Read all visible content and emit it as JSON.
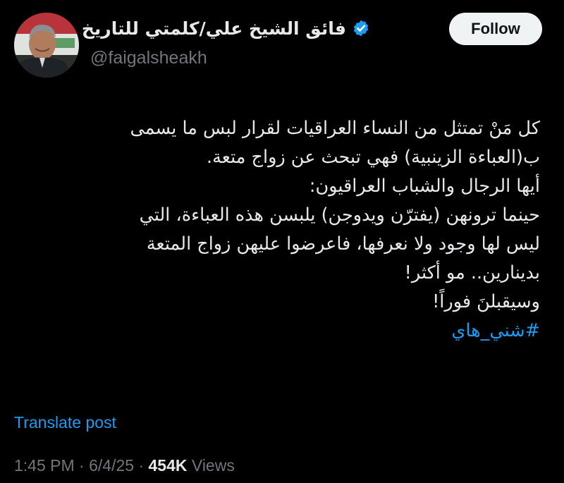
{
  "author": {
    "display_name": "فائق الشيخ علي/كلمتي للتاريخ",
    "handle": "@faigalsheakh",
    "verified_icon": "verified-badge-icon",
    "avatar": "profile-photo"
  },
  "follow_label": "Follow",
  "tweet": {
    "lines": [
      "كل مَنْ تمتثل من النساء العراقيات لقرار لبس ما يسمى",
      "ب(العباءة الزينبية) فهي تبحث عن زواج متعة.",
      "أيها الرجال والشباب العراقيون:",
      "حينما ترونهن (يفترّن ويدوجن) يلبسن هذه العباءة، التي",
      "ليس لها وجود ولا نعرفها، فاعرضوا عليهن زواج المتعة",
      "بدينارين.. مو أكثر!",
      "وسيقبلنَ فوراً!"
    ],
    "hashtag": "#شني_هاي"
  },
  "translate_label": "Translate post",
  "meta": {
    "time": "1:45 PM",
    "separator": "·",
    "date": "6/4/25",
    "views_count": "454K",
    "views_label": "Views"
  },
  "colors": {
    "background": "#000000",
    "text": "#e7e9ea",
    "secondary": "#71767b",
    "accent": "#1d9bf0",
    "follow_bg": "#eff3f4"
  }
}
